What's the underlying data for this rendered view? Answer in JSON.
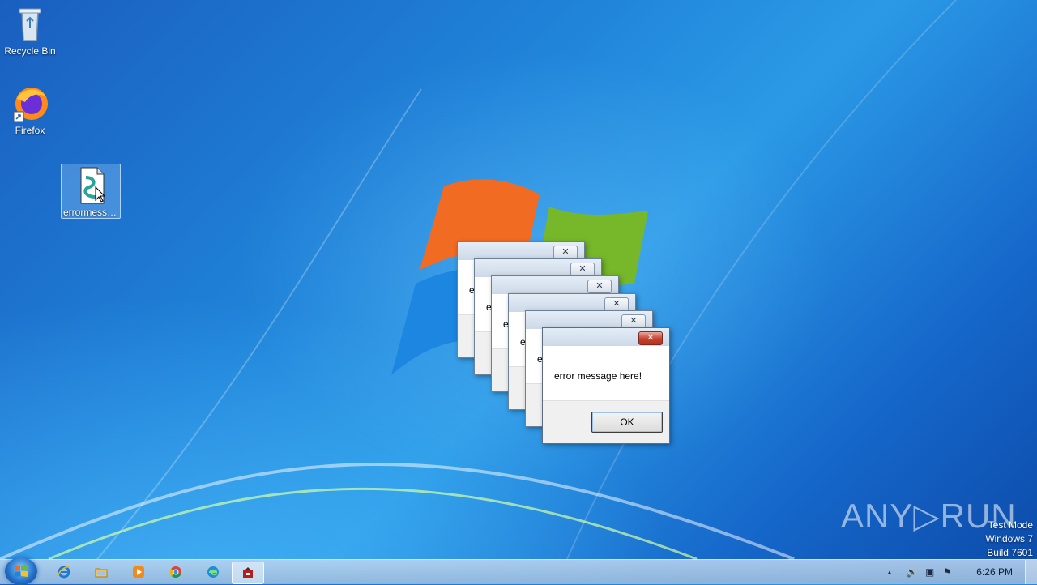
{
  "desktop": {
    "icons": [
      {
        "label": "Recycle Bin"
      },
      {
        "label": "Firefox"
      },
      {
        "label": "errormessa..."
      }
    ]
  },
  "dialogs": {
    "back_text": "e",
    "message": "error message here!",
    "ok_label": "OK",
    "close_glyph": "✕"
  },
  "watermark": {
    "brand": "ANY▷RUN",
    "test_mode": "Test Mode",
    "os": "Windows 7",
    "build": "Build 7601"
  },
  "taskbar": {
    "pinned": [
      "ie-icon",
      "explorer-icon",
      "media-player-icon",
      "chrome-icon",
      "edge-icon",
      "app-icon"
    ],
    "clock": "6:26 PM",
    "tray_up_arrow": "▲",
    "tray_volume": "🔊",
    "tray_network": "▣",
    "tray_flag": "⚑"
  },
  "colors": {
    "accent": "#1f82d8",
    "close_red": "#c7412f"
  }
}
